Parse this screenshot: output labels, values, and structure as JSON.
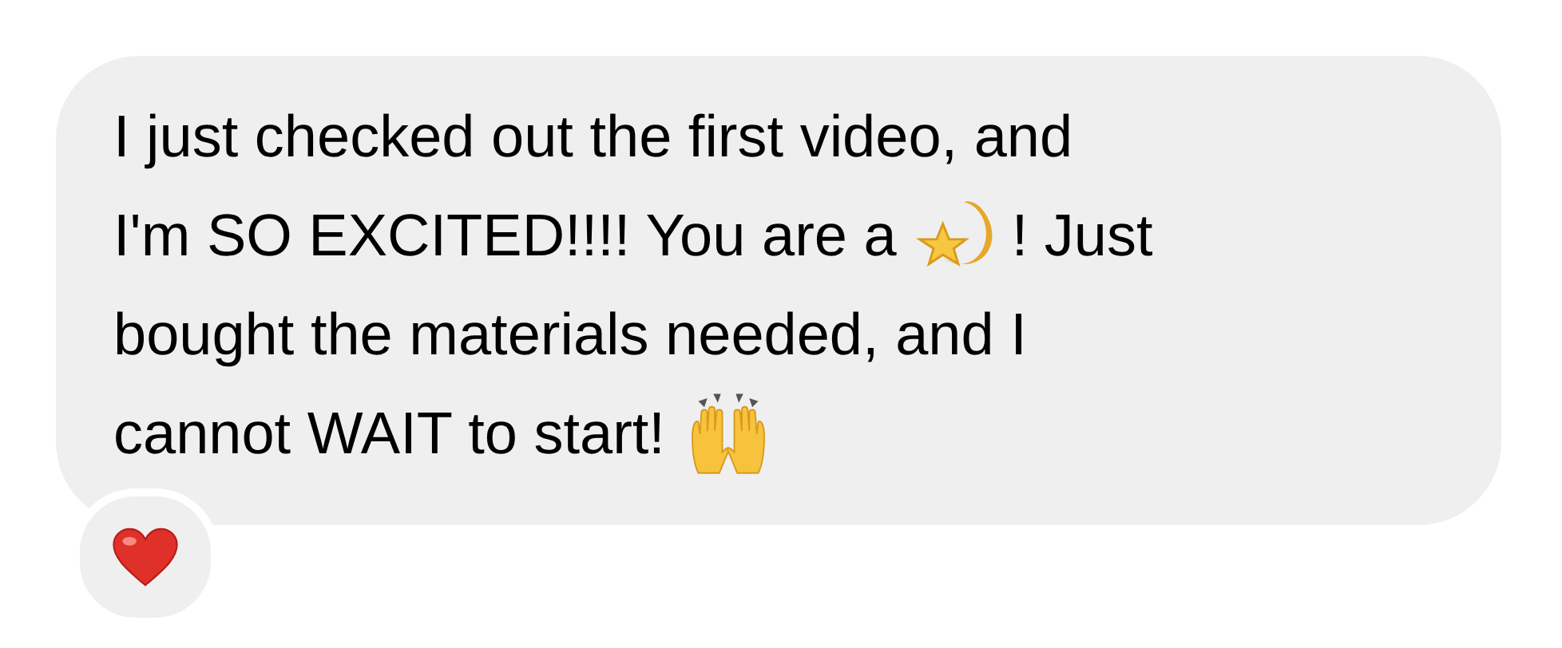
{
  "message": {
    "lines": [
      [
        {
          "kind": "text",
          "text": "I just checked out the first video, and"
        }
      ],
      [
        {
          "kind": "text",
          "text": "I'm SO EXCITED!!!! You are a"
        },
        {
          "kind": "star"
        },
        {
          "kind": "text",
          "text": "! Just"
        }
      ],
      [
        {
          "kind": "text",
          "text": "bought the materials needed, and I"
        }
      ],
      [
        {
          "kind": "text",
          "text": "cannot WAIT to start!"
        },
        {
          "kind": "hands"
        }
      ]
    ]
  },
  "reaction": {
    "kind": "heart"
  }
}
